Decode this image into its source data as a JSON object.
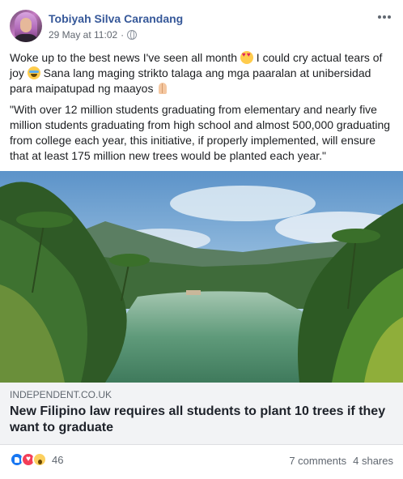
{
  "post": {
    "author": "Tobiyah Silva Carandang",
    "timestamp": "29 May at 11:02",
    "privacy_icon": "globe-icon",
    "more_icon": "ellipsis-icon",
    "text": {
      "line1_a": "Woke up to the best news I've seen all month",
      "line1_b": " I could cry actual tears of joy",
      "line1_c": " Sana lang maging strikto talaga ang mga paaralan at unibersidad para maipatupad ng maayos",
      "quote": "\"With over 12 million students graduating from elementary and nearly five million students graduating from high school and almost 500,000 graduating from college each year, this initiative, if properly implemented, will ensure that at least 175 million new trees would be planted each year.\""
    },
    "emojis": [
      "smiling-face-with-heart-eyes",
      "loudly-crying-face",
      "folded-hands"
    ]
  },
  "link": {
    "domain": "INDEPENDENT.CO.UK",
    "title": "New Filipino law requires all students to plant 10 trees if they want to graduate",
    "image_description_icon": "river-landscape-image"
  },
  "footer": {
    "reactions": [
      "like",
      "love",
      "wow"
    ],
    "reaction_count": "46",
    "comments": "7 comments",
    "shares": "4 shares"
  },
  "colors": {
    "author": "#365899",
    "meta": "#616770",
    "caption_bg": "#f2f3f5",
    "like": "#1877f2",
    "love": "#f33e58",
    "wow": "#fcd05f"
  }
}
